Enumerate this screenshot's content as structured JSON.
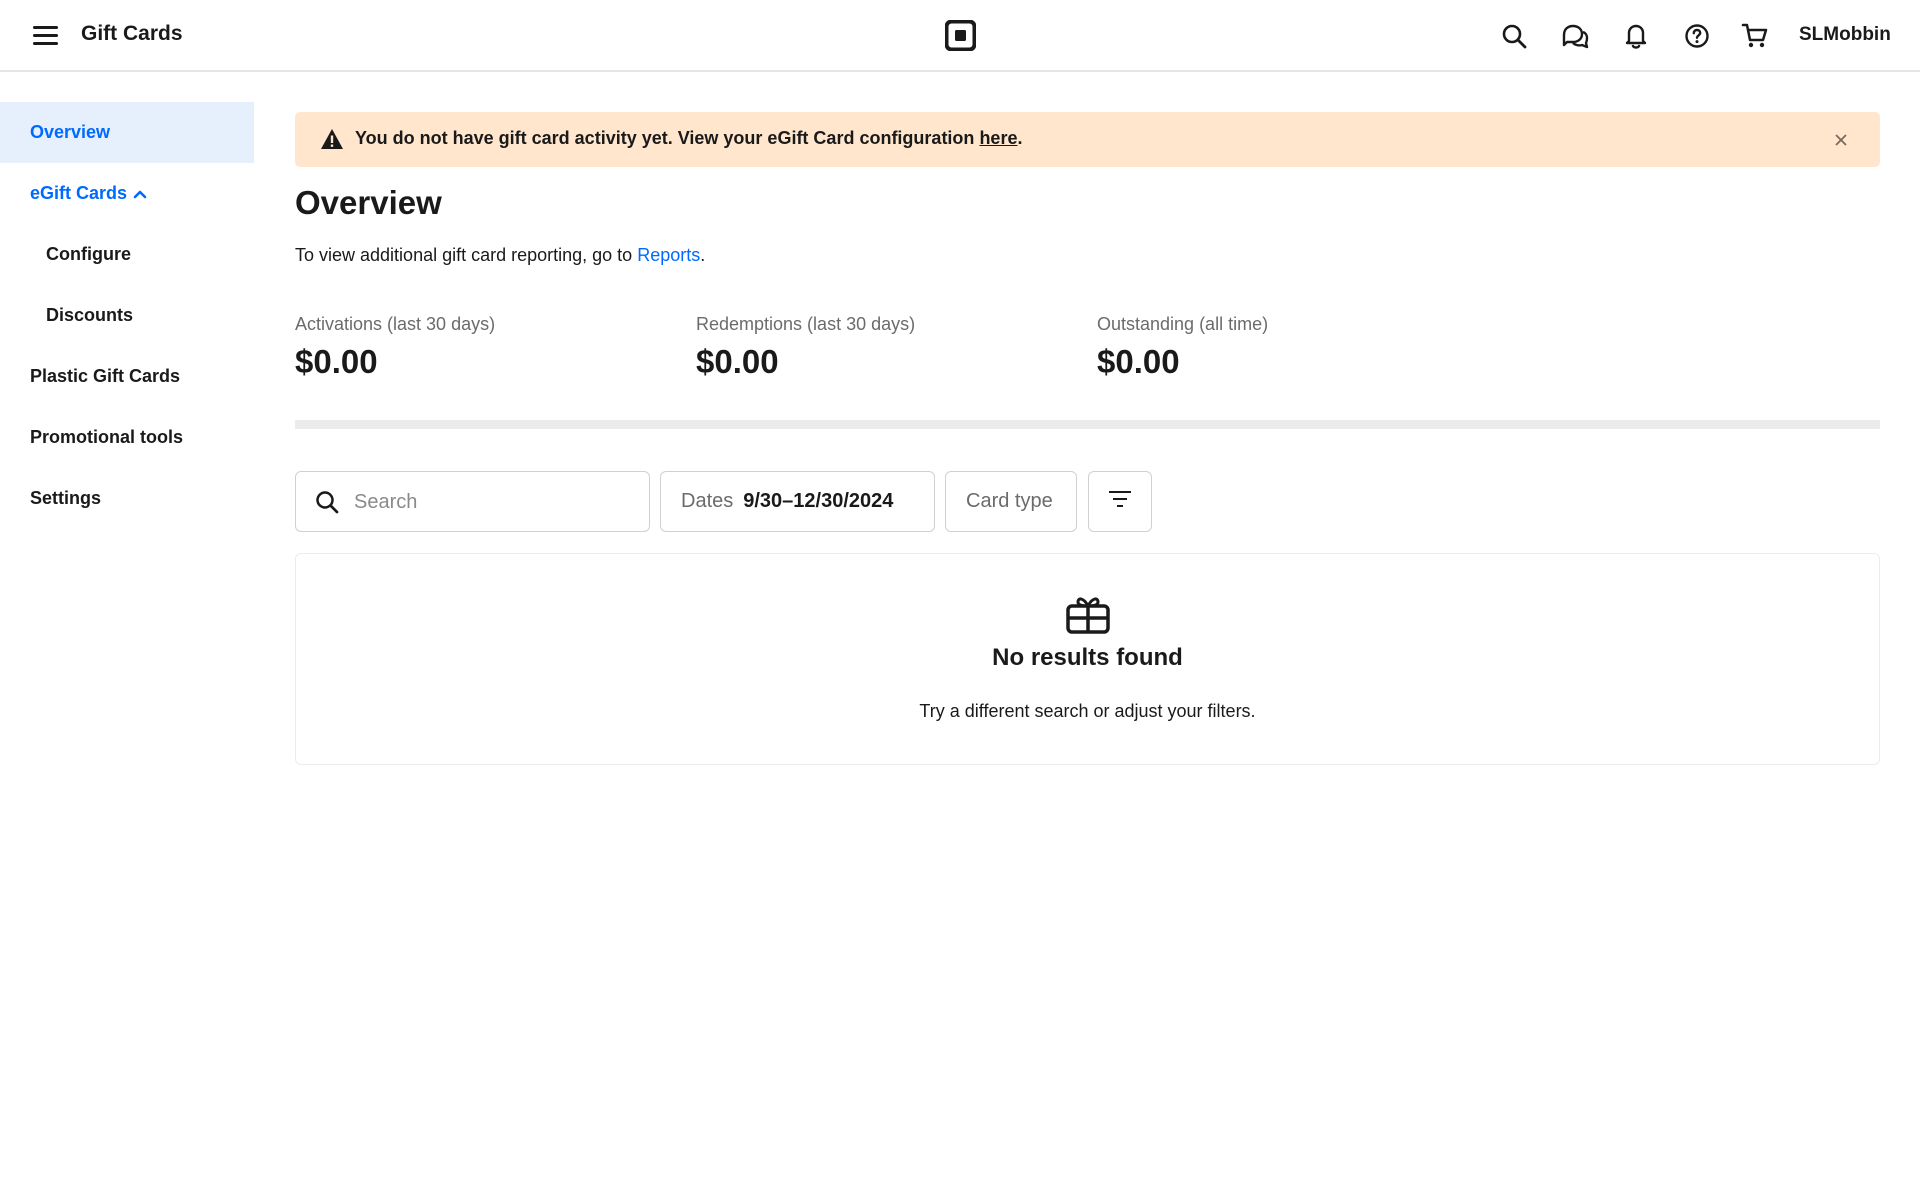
{
  "header": {
    "title": "Gift Cards",
    "user": "SLMobbin",
    "icons": [
      "menu-icon",
      "square-logo-icon",
      "search-icon",
      "messages-icon",
      "bell-icon",
      "help-icon",
      "cart-icon"
    ]
  },
  "sidebar": {
    "items": [
      {
        "label": "Overview",
        "active": true
      },
      {
        "label": "eGift Cards",
        "expanded": true
      },
      {
        "label": "Configure"
      },
      {
        "label": "Discounts"
      },
      {
        "label": "Plastic Gift Cards"
      },
      {
        "label": "Promotional tools"
      },
      {
        "label": "Settings"
      }
    ]
  },
  "banner": {
    "text": "You do not have gift card activity yet. View your eGift Card configuration ",
    "link": "here",
    "end": ".",
    "icon": "warning-icon",
    "close_icon": "close-icon",
    "background": "#ffe6cd"
  },
  "page": {
    "title": "Overview",
    "subtitle_prefix": "To view additional gift card reporting, go to ",
    "subtitle_link": "Reports",
    "subtitle_suffix": "."
  },
  "metrics": [
    {
      "label": "Activations (last 30 days)",
      "value": "$0.00"
    },
    {
      "label": "Redemptions (last 30 days)",
      "value": "$0.00"
    },
    {
      "label": "Outstanding (all time)",
      "value": "$0.00"
    }
  ],
  "filters": {
    "search_placeholder": "Search",
    "dates_label": "Dates",
    "dates_value": "9/30–12/30/2024",
    "card_type": "Card type",
    "more_icon": "filter-lines-icon"
  },
  "empty": {
    "icon": "gift-icon",
    "title": "No results found",
    "subtitle": "Try a different search or adjust your filters."
  },
  "colors": {
    "accent": "#006aff",
    "active_bg": "#e6f0fd",
    "text": "#1a1a1a",
    "muted": "#6b6b6b"
  }
}
